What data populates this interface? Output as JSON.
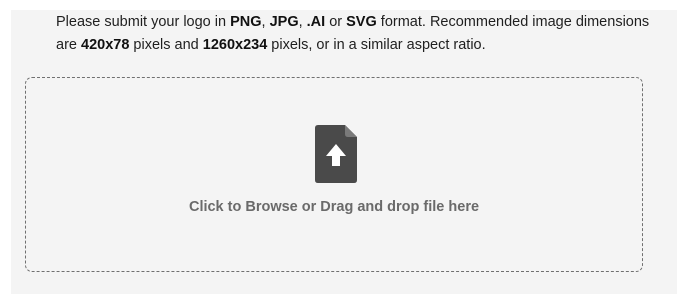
{
  "instructions": {
    "part1": "Please submit your logo in ",
    "fmt_png": "PNG",
    "sep1": ", ",
    "fmt_jpg": "JPG",
    "sep2": ", ",
    "fmt_ai": ".AI",
    "sep3": " or ",
    "fmt_svg": "SVG",
    "part2": " format. Recommended image dimensions are ",
    "dim1": "420x78",
    "part3": " pixels and ",
    "dim2": "1260x234",
    "part4": " pixels, or in a similar aspect ratio."
  },
  "dropzone": {
    "icon": "file-upload-icon",
    "label": "Click to Browse or Drag and drop file here"
  },
  "colors": {
    "panel_background": "#f4f4f4",
    "icon": "#4a4a4a",
    "label_text": "#6a6a6a",
    "border": "#707070"
  }
}
